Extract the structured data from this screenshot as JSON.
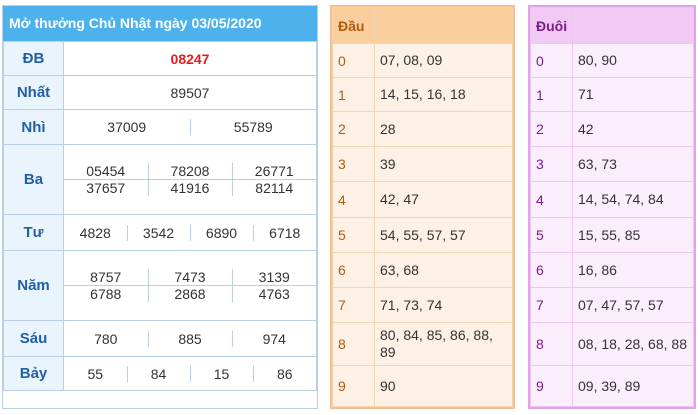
{
  "title": "Mở thưởng Chủ Nhật ngày 03/05/2020",
  "prizes": {
    "db": {
      "label": "ĐB",
      "values": [
        "08247"
      ]
    },
    "nhat": {
      "label": "Nhất",
      "values": [
        "89507"
      ]
    },
    "nhi": {
      "label": "Nhì",
      "values": [
        "37009",
        "55789"
      ]
    },
    "ba": {
      "label": "Ba",
      "values": [
        "05454",
        "78208",
        "26771",
        "37657",
        "41916",
        "82114"
      ]
    },
    "tu": {
      "label": "Tư",
      "values": [
        "4828",
        "3542",
        "6890",
        "6718"
      ]
    },
    "nam": {
      "label": "Năm",
      "values": [
        "8757",
        "7473",
        "3139",
        "6788",
        "2868",
        "4763"
      ]
    },
    "sau": {
      "label": "Sáu",
      "values": [
        "780",
        "885",
        "974"
      ]
    },
    "bay": {
      "label": "Bảy",
      "values": [
        "55",
        "84",
        "15",
        "86"
      ]
    }
  },
  "dau": {
    "header": "Đầu",
    "rows": [
      {
        "k": "0",
        "v": "07, 08, 09"
      },
      {
        "k": "1",
        "v": "14, 15, 16, 18"
      },
      {
        "k": "2",
        "v": "28"
      },
      {
        "k": "3",
        "v": "39"
      },
      {
        "k": "4",
        "v": "42, 47"
      },
      {
        "k": "5",
        "v": "54, 55, 57, 57"
      },
      {
        "k": "6",
        "v": "63, 68"
      },
      {
        "k": "7",
        "v": "71, 73, 74"
      },
      {
        "k": "8",
        "v": "80, 84, 85, 86, 88, 89"
      },
      {
        "k": "9",
        "v": "90"
      }
    ]
  },
  "duoi": {
    "header": "Đuôi",
    "rows": [
      {
        "k": "0",
        "v": "80, 90"
      },
      {
        "k": "1",
        "v": "71"
      },
      {
        "k": "2",
        "v": "42"
      },
      {
        "k": "3",
        "v": "63, 73"
      },
      {
        "k": "4",
        "v": "14, 54, 74, 84"
      },
      {
        "k": "5",
        "v": "15, 55, 85"
      },
      {
        "k": "6",
        "v": "16, 86"
      },
      {
        "k": "7",
        "v": "07, 47, 57, 57"
      },
      {
        "k": "8",
        "v": "08, 18, 28, 68, 88"
      },
      {
        "k": "9",
        "v": "09, 39, 89"
      }
    ]
  },
  "colors": {
    "title_bg": "#4db2ec",
    "db_value": "#e51c23",
    "label": "#2160a6",
    "dau_head": "#fbcf9d",
    "duoi_head": "#f1c9f5"
  }
}
